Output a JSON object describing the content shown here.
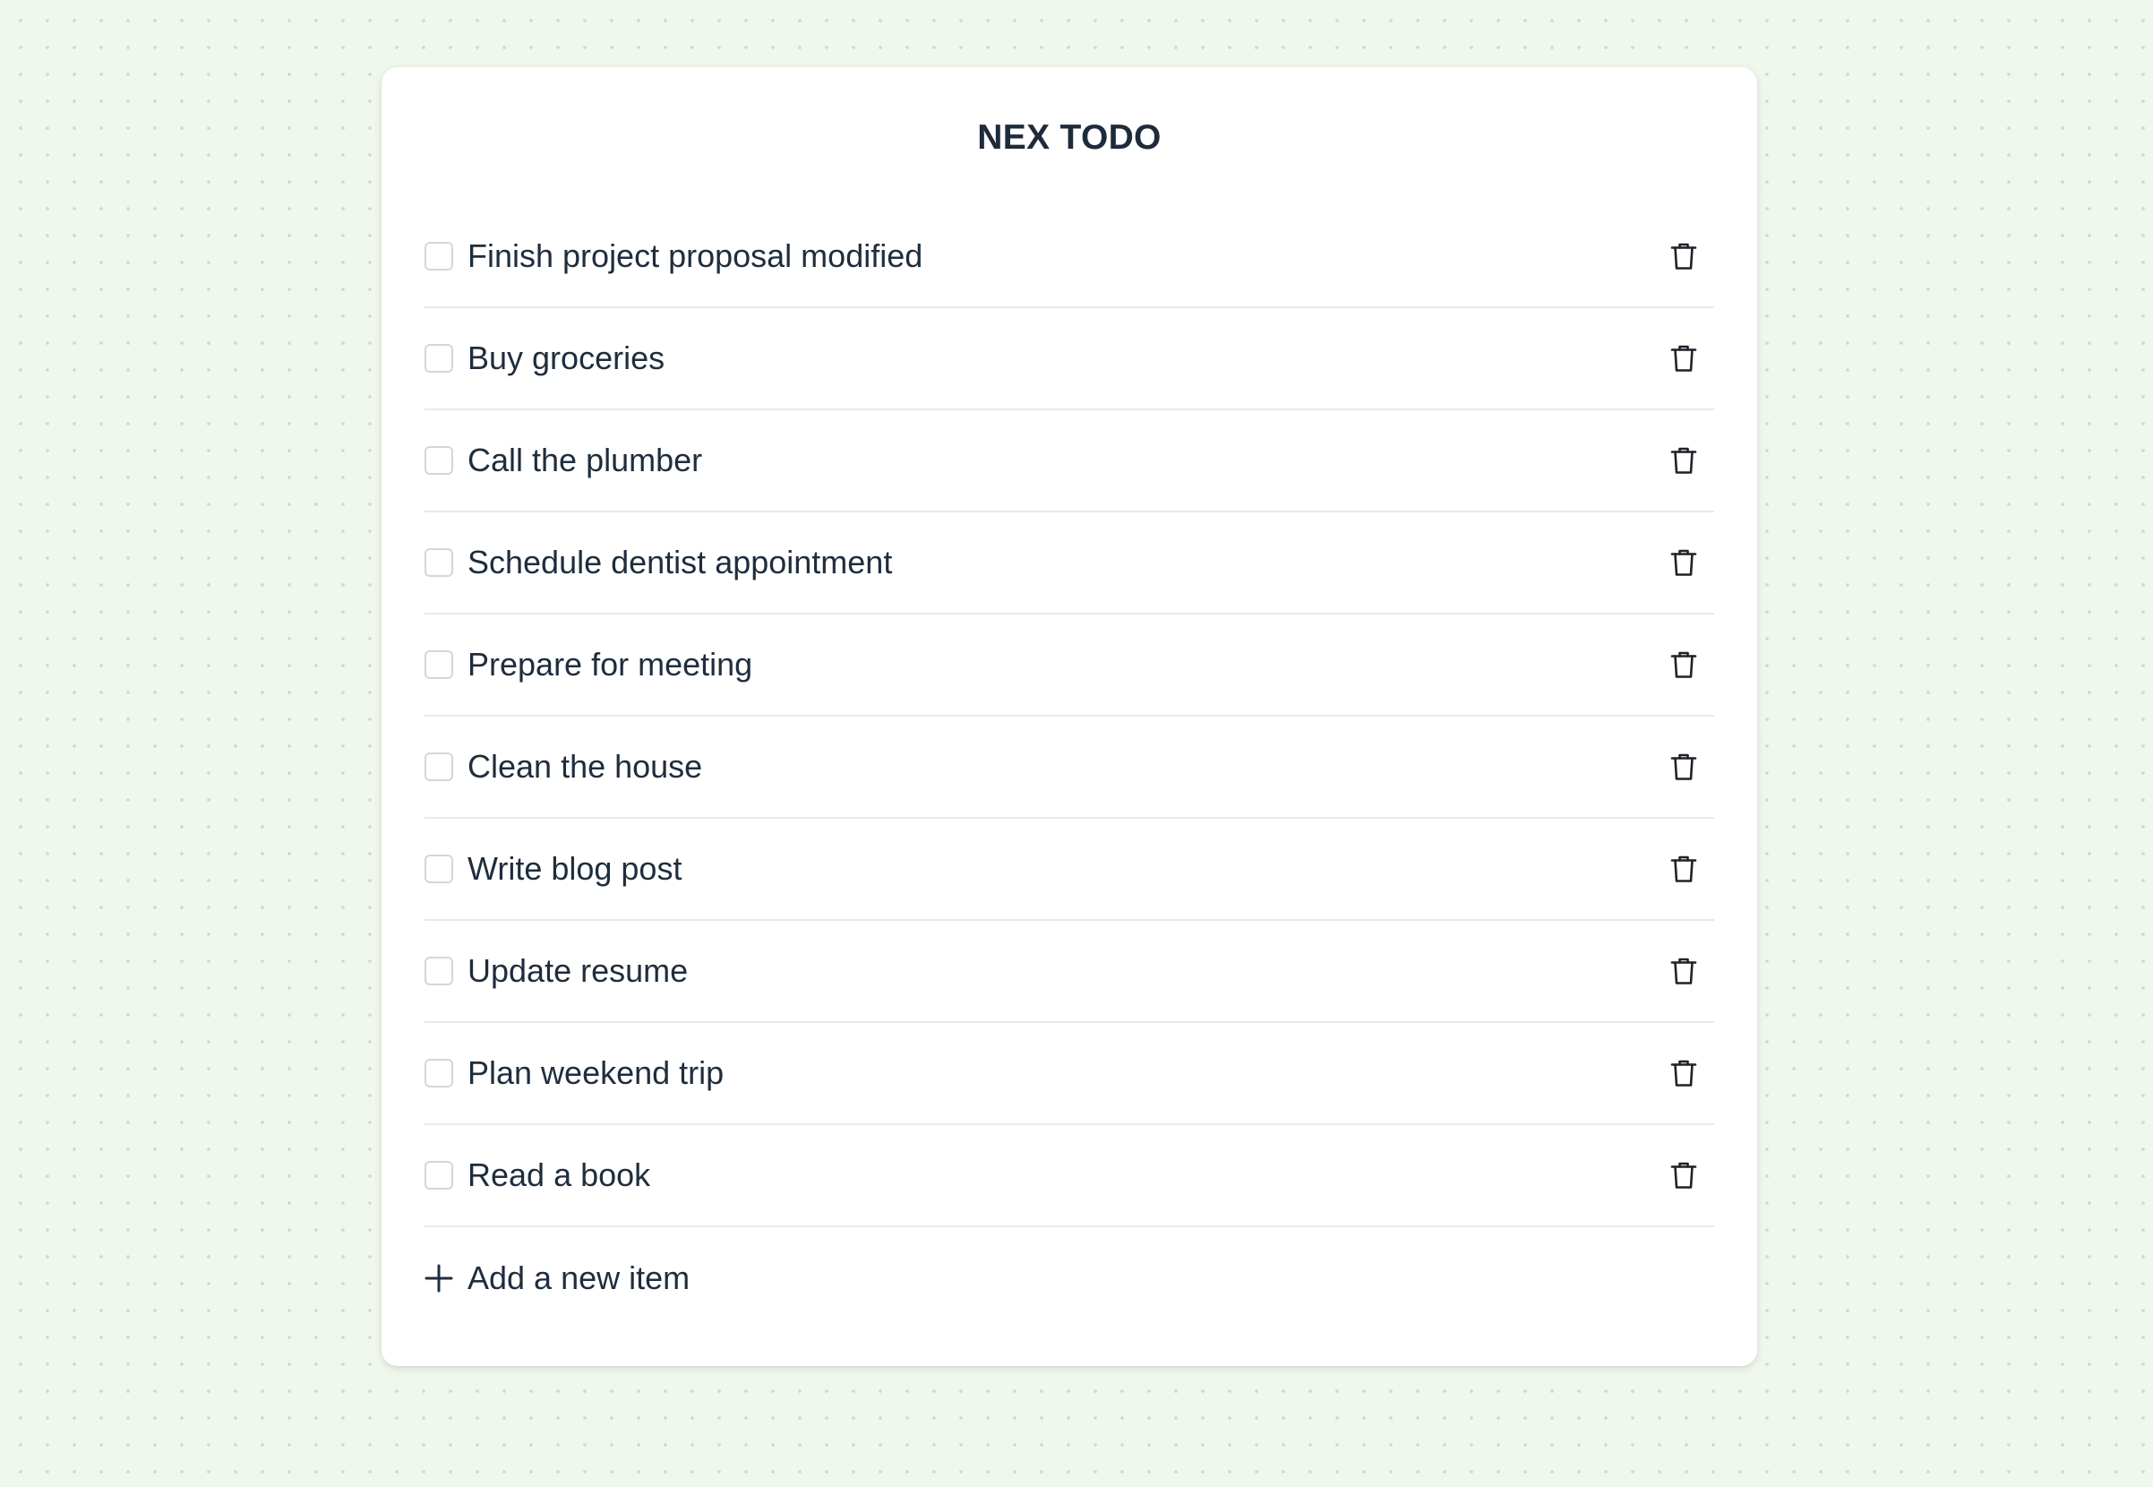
{
  "app": {
    "title": "NEX TODO"
  },
  "todos": [
    {
      "text": "Finish project proposal modified",
      "done": false
    },
    {
      "text": "Buy groceries",
      "done": false
    },
    {
      "text": "Call the plumber",
      "done": false
    },
    {
      "text": "Schedule dentist appointment",
      "done": false
    },
    {
      "text": "Prepare for meeting",
      "done": false
    },
    {
      "text": "Clean the house",
      "done": false
    },
    {
      "text": "Write blog post",
      "done": false
    },
    {
      "text": "Update resume",
      "done": false
    },
    {
      "text": "Plan weekend trip",
      "done": false
    },
    {
      "text": "Read a book",
      "done": false
    }
  ],
  "add_item": {
    "label": "Add a new item",
    "icon": "plus-icon"
  },
  "icons": {
    "delete": "trash-icon"
  },
  "colors": {
    "background": "#f0f8ee",
    "card": "#ffffff",
    "text": "#1f2d3d",
    "divider": "#e6e9ec"
  }
}
